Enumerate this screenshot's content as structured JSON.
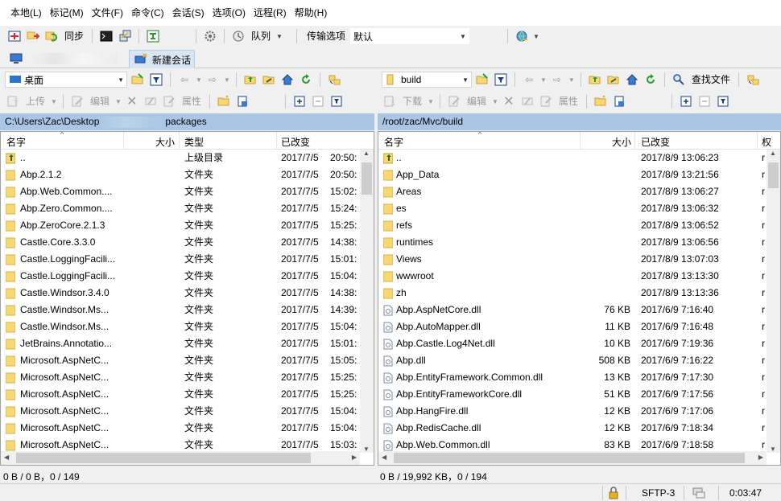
{
  "menu": [
    "本地(L)",
    "标记(M)",
    "文件(F)",
    "命令(C)",
    "会话(S)",
    "选项(O)",
    "远程(R)",
    "帮助(H)"
  ],
  "toolbar": {
    "sync": "同步",
    "queue": "队列",
    "transfer_label": "传输选项",
    "transfer_value": "默认"
  },
  "tabs": {
    "new_session": "新建会话"
  },
  "left": {
    "location": "桌面",
    "actions": {
      "upload": "上传",
      "edit": "编辑",
      "props": "属性"
    },
    "path": {
      "prefix": "C:\\Users\\Zac\\Desktop",
      "suffix": "packages"
    },
    "headers": {
      "name": "名字",
      "size": "大小",
      "type": "类型",
      "modified": "已改变"
    },
    "rows": [
      {
        "name": "..",
        "size": "",
        "type": "上级目录",
        "date": "2017/7/5",
        "time": "20:50:"
      },
      {
        "name": "Abp.2.1.2",
        "size": "",
        "type": "文件夹",
        "date": "2017/7/5",
        "time": "20:50:"
      },
      {
        "name": "Abp.Web.Common....",
        "size": "",
        "type": "文件夹",
        "date": "2017/7/5",
        "time": "15:02:"
      },
      {
        "name": "Abp.Zero.Common....",
        "size": "",
        "type": "文件夹",
        "date": "2017/7/5",
        "time": "15:24:"
      },
      {
        "name": "Abp.ZeroCore.2.1.3",
        "size": "",
        "type": "文件夹",
        "date": "2017/7/5",
        "time": "15:25:"
      },
      {
        "name": "Castle.Core.3.3.0",
        "size": "",
        "type": "文件夹",
        "date": "2017/7/5",
        "time": "14:38:"
      },
      {
        "name": "Castle.LoggingFacili...",
        "size": "",
        "type": "文件夹",
        "date": "2017/7/5",
        "time": "15:01:"
      },
      {
        "name": "Castle.LoggingFacili...",
        "size": "",
        "type": "文件夹",
        "date": "2017/7/5",
        "time": "15:04:"
      },
      {
        "name": "Castle.Windsor.3.4.0",
        "size": "",
        "type": "文件夹",
        "date": "2017/7/5",
        "time": "14:38:"
      },
      {
        "name": "Castle.Windsor.Ms...",
        "size": "",
        "type": "文件夹",
        "date": "2017/7/5",
        "time": "14:39:"
      },
      {
        "name": "Castle.Windsor.Ms...",
        "size": "",
        "type": "文件夹",
        "date": "2017/7/5",
        "time": "15:04:"
      },
      {
        "name": "JetBrains.Annotatio...",
        "size": "",
        "type": "文件夹",
        "date": "2017/7/5",
        "time": "15:01:"
      },
      {
        "name": "Microsoft.AspNetC...",
        "size": "",
        "type": "文件夹",
        "date": "2017/7/5",
        "time": "15:05:"
      },
      {
        "name": "Microsoft.AspNetC...",
        "size": "",
        "type": "文件夹",
        "date": "2017/7/5",
        "time": "15:25:"
      },
      {
        "name": "Microsoft.AspNetC...",
        "size": "",
        "type": "文件夹",
        "date": "2017/7/5",
        "time": "15:25:"
      },
      {
        "name": "Microsoft.AspNetC...",
        "size": "",
        "type": "文件夹",
        "date": "2017/7/5",
        "time": "15:04:"
      },
      {
        "name": "Microsoft.AspNetC...",
        "size": "",
        "type": "文件夹",
        "date": "2017/7/5",
        "time": "15:04:"
      },
      {
        "name": "Microsoft.AspNetC...",
        "size": "",
        "type": "文件夹",
        "date": "2017/7/5",
        "time": "15:03:"
      }
    ],
    "status": "0 B / 0 B，0 / 149"
  },
  "right": {
    "location": "build",
    "find": "查找文件",
    "actions": {
      "download": "下载",
      "edit": "编辑",
      "props": "属性"
    },
    "path": "/root/zac/Mvc/build",
    "headers": {
      "name": "名字",
      "size": "大小",
      "modified": "已改变",
      "rights": "权"
    },
    "rows": [
      {
        "name": "..",
        "size": "",
        "date": "2017/8/9 13:06:23",
        "kind": "up"
      },
      {
        "name": "App_Data",
        "size": "",
        "date": "2017/8/9 13:21:56",
        "kind": "folder"
      },
      {
        "name": "Areas",
        "size": "",
        "date": "2017/8/9 13:06:27",
        "kind": "folder"
      },
      {
        "name": "es",
        "size": "",
        "date": "2017/8/9 13:06:32",
        "kind": "folder"
      },
      {
        "name": "refs",
        "size": "",
        "date": "2017/8/9 13:06:52",
        "kind": "folder"
      },
      {
        "name": "runtimes",
        "size": "",
        "date": "2017/8/9 13:06:56",
        "kind": "folder"
      },
      {
        "name": "Views",
        "size": "",
        "date": "2017/8/9 13:07:03",
        "kind": "folder"
      },
      {
        "name": "wwwroot",
        "size": "",
        "date": "2017/8/9 13:13:30",
        "kind": "folder"
      },
      {
        "name": "zh",
        "size": "",
        "date": "2017/8/9 13:13:36",
        "kind": "folder"
      },
      {
        "name": "Abp.AspNetCore.dll",
        "size": "76 KB",
        "date": "2017/6/9 7:16:40",
        "kind": "dll"
      },
      {
        "name": "Abp.AutoMapper.dll",
        "size": "11 KB",
        "date": "2017/6/9 7:16:48",
        "kind": "dll"
      },
      {
        "name": "Abp.Castle.Log4Net.dll",
        "size": "10 KB",
        "date": "2017/6/9 7:19:36",
        "kind": "dll"
      },
      {
        "name": "Abp.dll",
        "size": "508 KB",
        "date": "2017/6/9 7:16:22",
        "kind": "dll"
      },
      {
        "name": "Abp.EntityFramework.Common.dll",
        "size": "13 KB",
        "date": "2017/6/9 7:17:30",
        "kind": "dll"
      },
      {
        "name": "Abp.EntityFrameworkCore.dll",
        "size": "51 KB",
        "date": "2017/6/9 7:17:56",
        "kind": "dll"
      },
      {
        "name": "Abp.HangFire.dll",
        "size": "12 KB",
        "date": "2017/6/9 7:17:06",
        "kind": "dll"
      },
      {
        "name": "Abp.RedisCache.dll",
        "size": "12 KB",
        "date": "2017/6/9 7:18:34",
        "kind": "dll"
      },
      {
        "name": "Abp.Web.Common.dll",
        "size": "83 KB",
        "date": "2017/6/9 7:18:58",
        "kind": "dll"
      }
    ],
    "status": "0 B / 19,992 KB，0 / 194"
  },
  "statusbar": {
    "protocol": "SFTP-3",
    "timer": "0:03:47"
  },
  "colors": {
    "path_bar": "#a9c6e4",
    "folder": "#f8d775",
    "accent": "#1a6fc6"
  }
}
